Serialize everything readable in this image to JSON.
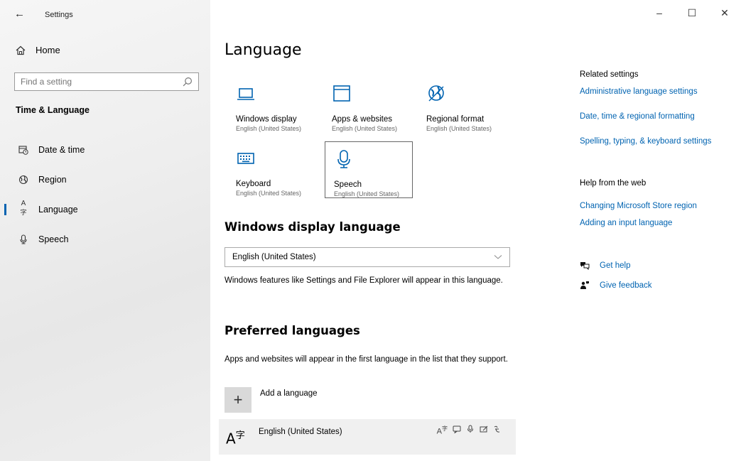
{
  "window": {
    "title": "Settings",
    "back_glyph": "←",
    "minimize_glyph": "–",
    "maximize_glyph": "☐",
    "close_glyph": "✕"
  },
  "sidebar": {
    "home_label": "Home",
    "home_icon": "home-icon",
    "search_placeholder": "Find a setting",
    "section_title": "Time & Language",
    "items": [
      {
        "label": "Date & time",
        "icon": "date-time-icon",
        "glyph": "⊞"
      },
      {
        "label": "Region",
        "icon": "globe-icon",
        "glyph": "◍"
      },
      {
        "label": "Language",
        "icon": "language-icon",
        "glyph": "A字",
        "active": true
      },
      {
        "label": "Speech",
        "icon": "microphone-icon",
        "glyph": "🎙"
      }
    ]
  },
  "main": {
    "title": "Language",
    "tiles": [
      {
        "label": "Windows display",
        "sub": "English (United States)",
        "icon": "laptop-icon"
      },
      {
        "label": "Apps & websites",
        "sub": "English (United States)",
        "icon": "window-icon"
      },
      {
        "label": "Regional format",
        "sub": "English (United States)",
        "icon": "globe-icon"
      },
      {
        "label": "Keyboard",
        "sub": "English (United States)",
        "icon": "keyboard-icon"
      },
      {
        "label": "Speech",
        "sub": "English (United States)",
        "icon": "microphone-icon",
        "selected": true
      }
    ],
    "display_language": {
      "heading": "Windows display language",
      "selected": "English (United States)",
      "description": "Windows features like Settings and File Explorer will appear in this language."
    },
    "preferred": {
      "heading": "Preferred languages",
      "description": "Apps and websites will appear in the first language in the list that they support.",
      "add_label": "Add a language",
      "add_glyph": "+",
      "languages": [
        {
          "name": "English (United States)",
          "glyph": "A字",
          "capabilities": [
            "A字",
            "⊡",
            "🎙",
            "✎",
            "✍"
          ]
        }
      ]
    }
  },
  "right": {
    "related_heading": "Related settings",
    "related_links": [
      "Administrative language settings",
      "Date, time & regional formatting",
      "Spelling, typing, & keyboard settings"
    ],
    "help_heading": "Help from the web",
    "help_links": [
      "Changing Microsoft Store region",
      "Adding an input language"
    ],
    "get_help_label": "Get help",
    "give_feedback_label": "Give feedback"
  },
  "colors": {
    "accent": "#0063b1",
    "sidebar_bg": "#eeeeee",
    "active_indicator": "#0063b1"
  }
}
